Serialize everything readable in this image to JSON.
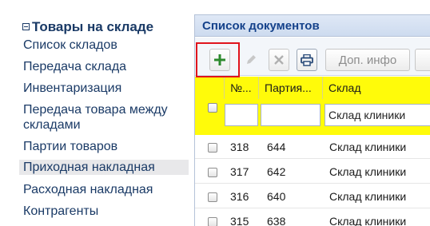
{
  "nav": {
    "title": "Товары на складе",
    "items": [
      {
        "label": "Список складов",
        "selected": false
      },
      {
        "label": "Передача склада",
        "selected": false
      },
      {
        "label": "Инвентаризация",
        "selected": false
      },
      {
        "label": "Передача товара между складами",
        "selected": false
      },
      {
        "label": "Партии товаров",
        "selected": false
      },
      {
        "label": "Приходная накладная",
        "selected": true
      },
      {
        "label": "Расходная накладная",
        "selected": false
      },
      {
        "label": "Контрагенты",
        "selected": false
      }
    ]
  },
  "panel": {
    "title": "Список документов",
    "toolbar": {
      "add_icon": "plus-icon",
      "edit_icon": "pencil-icon",
      "delete_icon": "close-icon",
      "print_icon": "printer-icon",
      "info_label": "Доп. инфо",
      "highlight_color": "#e0141c"
    },
    "grid": {
      "header_color": "#fffb0a",
      "columns": [
        "№...",
        "Партия...",
        "Склад"
      ],
      "filters": {
        "num": "",
        "batch": "",
        "store": "Склад клиники"
      },
      "rows": [
        {
          "num": "318",
          "batch": "644",
          "store": "Склад клиники"
        },
        {
          "num": "317",
          "batch": "642",
          "store": "Склад клиники"
        },
        {
          "num": "316",
          "batch": "640",
          "store": "Склад клиники"
        },
        {
          "num": "315",
          "batch": "638",
          "store": "Склад клиники"
        }
      ]
    }
  }
}
